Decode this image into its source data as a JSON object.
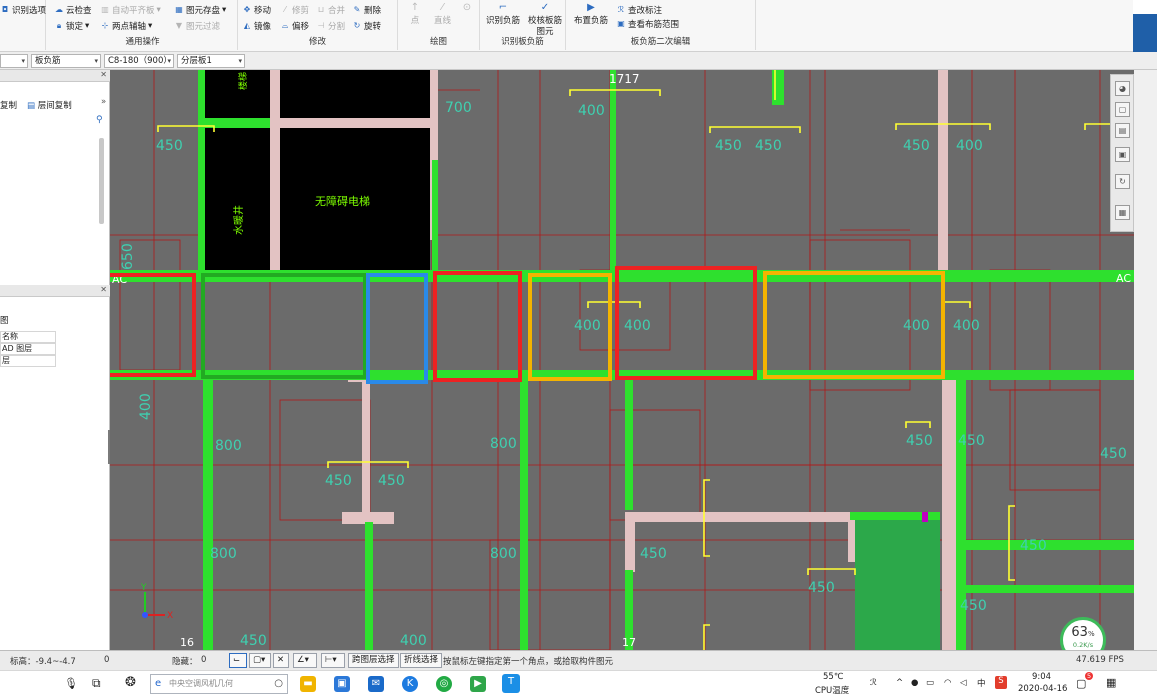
{
  "ribbon": {
    "group1": {
      "items": [
        "识别选项"
      ]
    },
    "group2": {
      "items": [
        "云检查",
        "自动平齐板",
        "锁定",
        "两点辅轴"
      ],
      "extra": [
        "图元存盘",
        "图元过滤"
      ],
      "label": "通用操作"
    },
    "group3": {
      "items": [
        "移动",
        "修剪",
        "合并",
        "删除",
        "镜像",
        "偏移",
        "分割",
        "旋转"
      ],
      "label": "修改"
    },
    "group4": {
      "items": [
        "点",
        "直线"
      ],
      "label": "绘图"
    },
    "group5": {
      "items": [
        "识别负筋",
        "校核板筋图元"
      ],
      "label": "识别板负筋"
    },
    "group6": {
      "items": [
        "布置负筋",
        "查改标注",
        "查看布筋范围"
      ],
      "label": "板负筋二次编辑"
    }
  },
  "filter": {
    "combo1": "",
    "combo2": "板负筋",
    "combo3": "C8-180（900）",
    "combo4": "分层板1"
  },
  "leftpanel": {
    "copy_left": "复制",
    "copy_floor": "层间复制",
    "table": {
      "header": "名称",
      "rows": [
        "AD 图层",
        "层"
      ]
    },
    "misc": "图"
  },
  "canvas": {
    "top_label": "1717",
    "ac_left": "AC",
    "ac_right": "AC",
    "axis16": "16",
    "axis17": "17",
    "room1": "无障碍电梯",
    "room2": "水暖井",
    "room3": "楼梯",
    "dims": [
      "700",
      "650",
      "400",
      "450",
      "650",
      "400",
      "800"
    ],
    "colors": {
      "bg": "#6b6b6b",
      "beam": "#2ee02e",
      "wall": "#e0bcbc",
      "rebar": "#ffff33",
      "dim": "#3fd0b0",
      "grid": "#c02020"
    }
  },
  "right_toolbar": {
    "icons": [
      "sphere-icon",
      "cube-icon",
      "layers-icon",
      "box-icon",
      "rotate-icon",
      "grid-icon"
    ]
  },
  "gauge": {
    "percent": "63",
    "unit": "%",
    "speed": "0.2K/s"
  },
  "statusbar": {
    "elevation": "标高：-9.4~-4.7",
    "zero": "0",
    "hidden": "隐藏：",
    "hidden_val": "0",
    "btn_layer": "跨图层选择",
    "btn_polyline": "折线选择",
    "hint": "按鼠标左键指定第一个角点，或拾取构件图元",
    "fps": "47.619 FPS"
  },
  "taskbar": {
    "search": "中央空调风机几何",
    "temp": "55℃",
    "temp_label": "CPU温度",
    "ime": "中",
    "time": "9:04",
    "date": "2020-04-16",
    "badge": "5"
  }
}
